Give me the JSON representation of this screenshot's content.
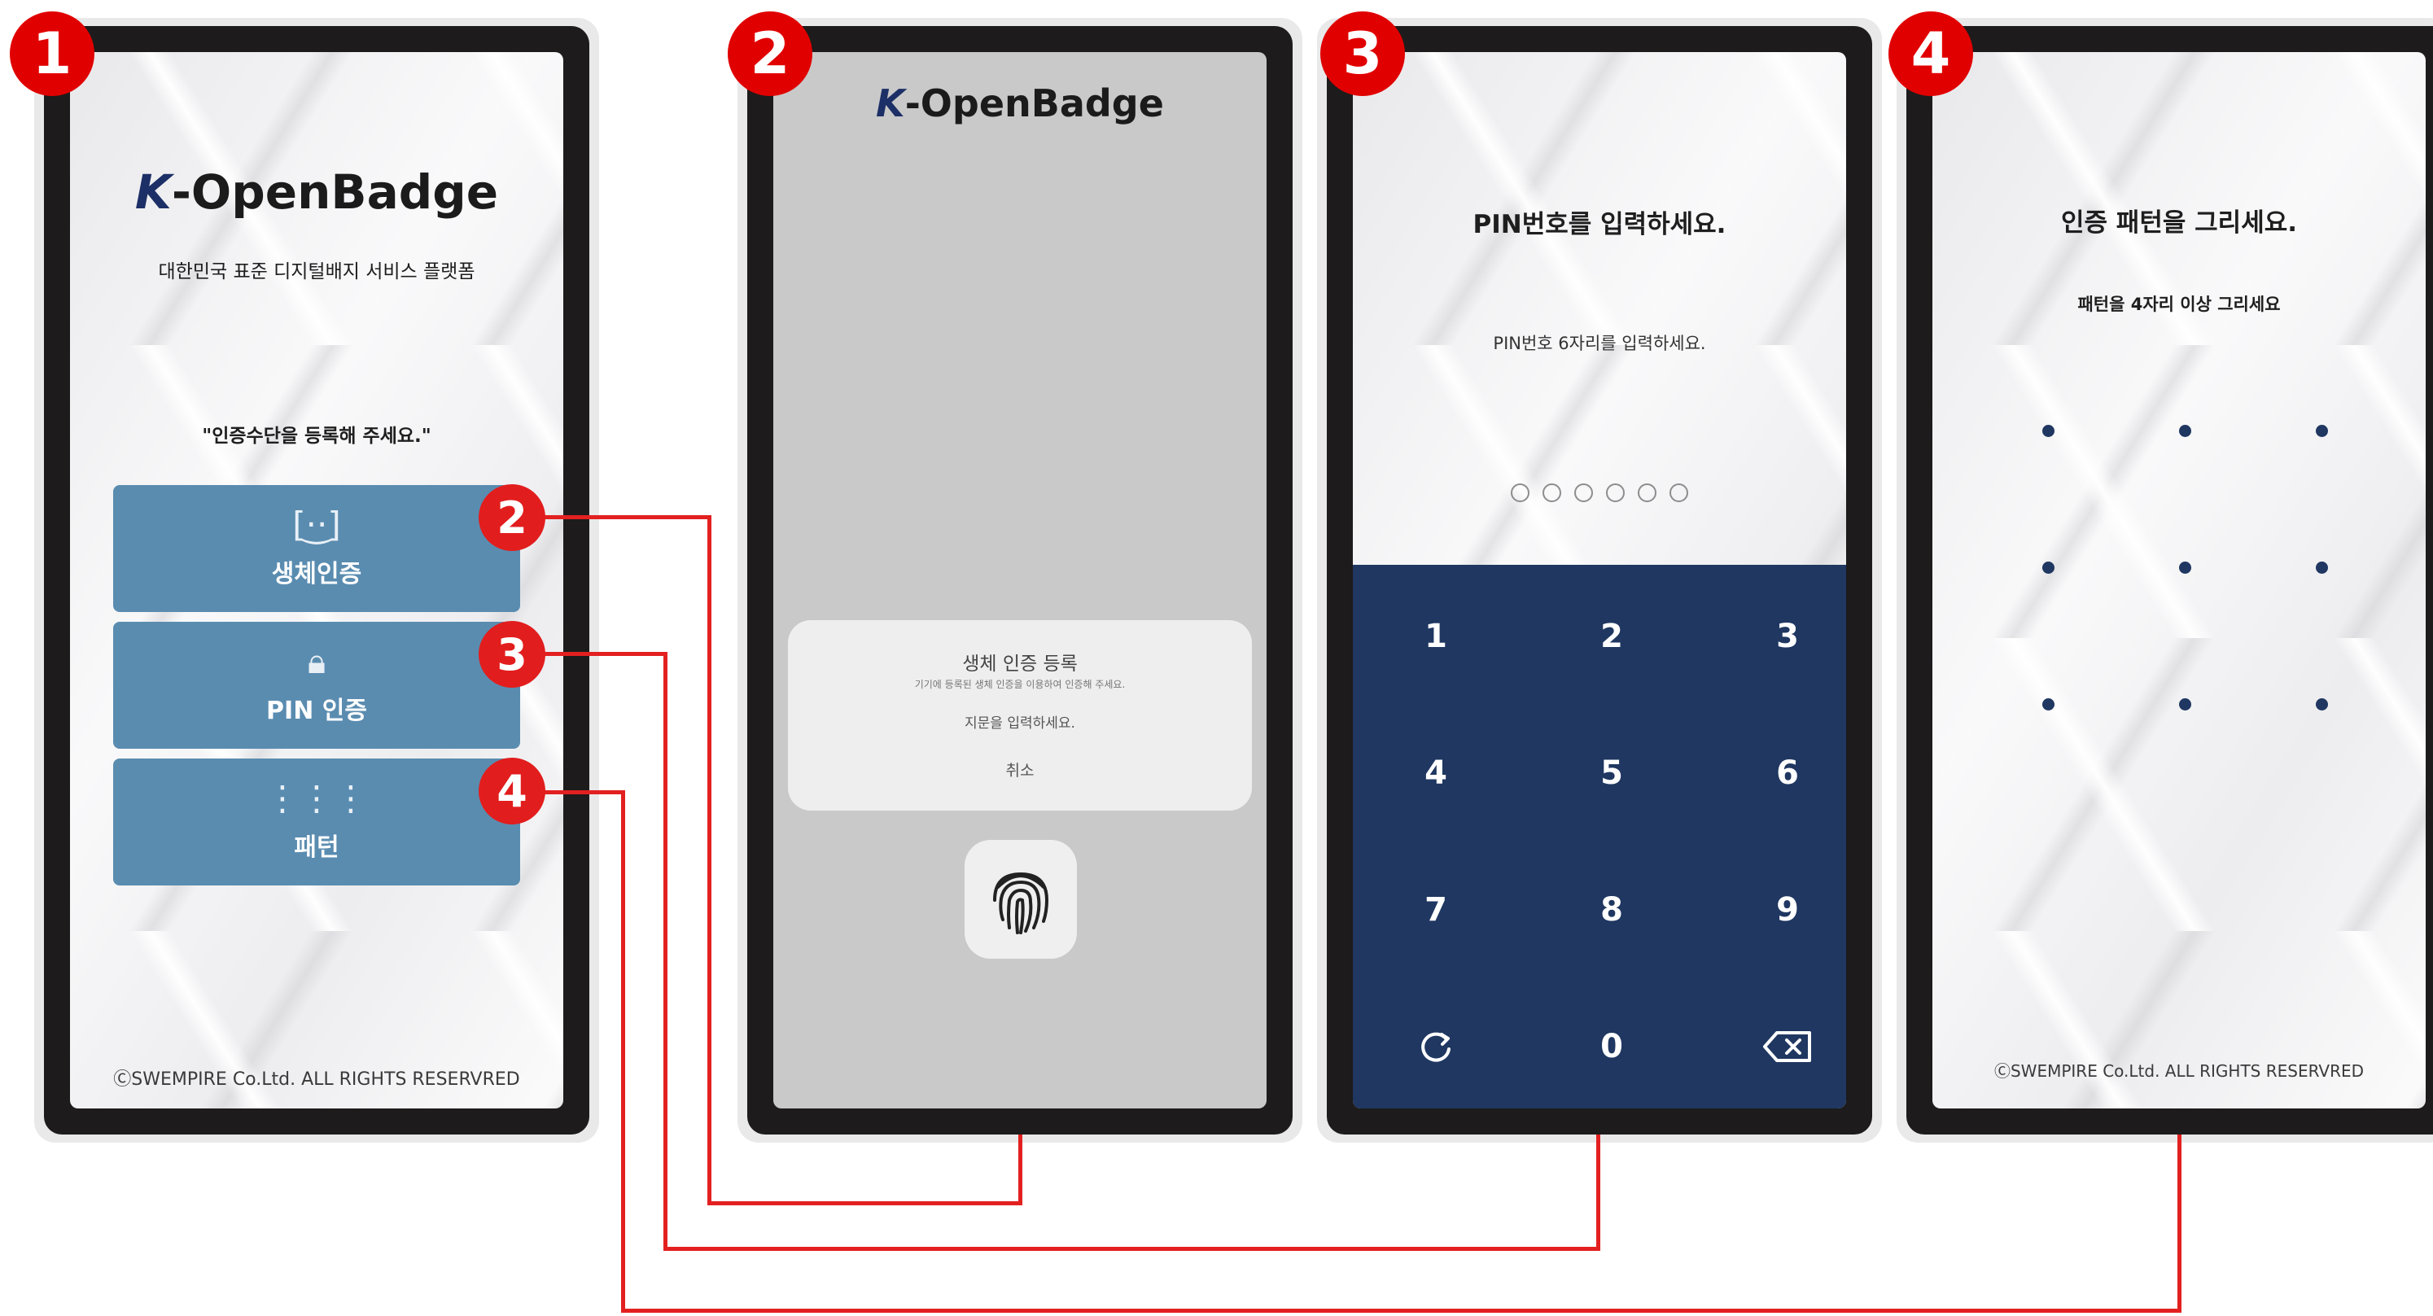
{
  "steps": [
    "1",
    "2",
    "3",
    "4"
  ],
  "logo": {
    "k": "K",
    "rest": "-OpenBadge"
  },
  "screen1": {
    "subtitle": "대한민국 표준 디지털배지 서비스 플랫폼",
    "prompt": "\"인증수단을 등록해 주세요.\"",
    "buttons": [
      {
        "label": "생체인증",
        "icon": "face-scan-icon",
        "glyph": "[·͜·]",
        "badge": "2"
      },
      {
        "label": "PIN 인증",
        "icon": "lock-icon",
        "glyph": "🔒︎",
        "badge": "3"
      },
      {
        "label": "패턴",
        "icon": "pattern-grid-icon",
        "glyph": "⋮⋮⋮",
        "badge": "4"
      }
    ],
    "copyright": "ⒸSWEMPIRE Co.Ltd. ALL RIGHTS RESERVRED"
  },
  "screen2": {
    "dialog_title": "생체 인증 등록",
    "dialog_sub": "기기에 등록된 생체 인증을 이용하여 인증해 주세요.",
    "dialog_instruction": "지문을 입력하세요.",
    "cancel": "취소",
    "icon": "fingerprint-icon"
  },
  "screen3": {
    "title": "PIN번호를 입력하세요.",
    "subtitle": "PIN번호 6자리를 입력하세요.",
    "pin_length": 6,
    "keys": [
      "1",
      "2",
      "3",
      "4",
      "5",
      "6",
      "7",
      "8",
      "9",
      "↻",
      "0",
      "⌫"
    ],
    "refresh_icon": "refresh-icon",
    "backspace_icon": "backspace-icon"
  },
  "screen4": {
    "title": "인증 패턴을 그리세요.",
    "subtitle": "패턴을 4자리 이상 그리세요",
    "copyright": "ⒸSWEMPIRE Co.Ltd. ALL RIGHTS RESERVRED"
  },
  "colors": {
    "accent_red": "#e10000",
    "button_blue": "#5a8cb0",
    "keypad_navy": "#1f3761"
  }
}
